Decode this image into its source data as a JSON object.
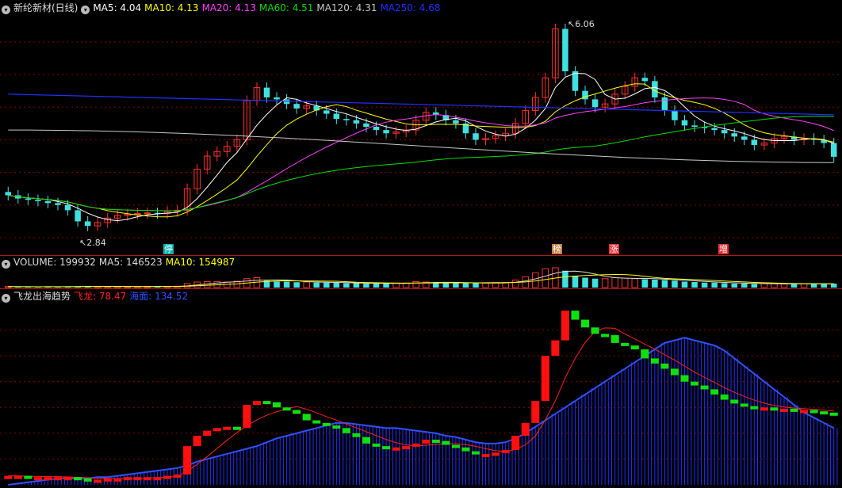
{
  "main": {
    "title": "新纶新材(日线)",
    "indicators": [
      {
        "label": "MA5: 4.04",
        "color": "#ffffff"
      },
      {
        "label": "MA10: 4.13",
        "color": "#ffff00"
      },
      {
        "label": "MA20: 4.13",
        "color": "#ff40ff"
      },
      {
        "label": "MA60: 4.51",
        "color": "#00e000"
      },
      {
        "label": "MA120: 4.31",
        "color": "#c8c8c8"
      },
      {
        "label": "MA250: 4.68",
        "color": "#2030ff"
      }
    ],
    "high_label": "6.06",
    "low_label": "2.84",
    "event_marks": [
      {
        "label": "停",
        "bg": "#00b0b0"
      },
      {
        "label": "榜",
        "bg": "#c08040"
      },
      {
        "label": "涨",
        "bg": "#e03030"
      },
      {
        "label": "增",
        "bg": "#e03030"
      }
    ]
  },
  "volume": {
    "items": [
      {
        "label": "VOLUME: 199932",
        "color": "#dddddd"
      },
      {
        "label": "MA5: 146523",
        "color": "#dddddd"
      },
      {
        "label": "MA10: 154987",
        "color": "#ffff00"
      }
    ]
  },
  "indicator": {
    "name": "飞龙出海趋势",
    "items": [
      {
        "label": "飞龙: 78.47",
        "color": "#ff2020"
      },
      {
        "label": "海面: 134.52",
        "color": "#3050ff"
      }
    ]
  },
  "colors": {
    "up": "#ff3030",
    "down": "#40e0e0",
    "grid": "#8b0000",
    "separator": "#b01818"
  },
  "chart_data": {
    "type": "candlestick",
    "close": [
      3.45,
      3.4,
      3.38,
      3.36,
      3.33,
      3.3,
      3.22,
      3.05,
      2.98,
      3.03,
      3.1,
      3.14,
      3.16,
      3.17,
      3.18,
      3.17,
      3.2,
      3.22,
      3.55,
      3.85,
      4.05,
      4.12,
      4.2,
      4.3,
      4.9,
      5.1,
      4.95,
      4.92,
      4.85,
      4.78,
      4.82,
      4.75,
      4.7,
      4.62,
      4.6,
      4.55,
      4.5,
      4.45,
      4.4,
      4.42,
      4.45,
      4.6,
      4.72,
      4.68,
      4.6,
      4.55,
      4.4,
      4.3,
      4.32,
      4.36,
      4.4,
      4.55,
      4.75,
      4.95,
      5.25,
      6.0,
      5.35,
      5.05,
      4.92,
      4.8,
      4.85,
      5.0,
      5.12,
      5.25,
      5.2,
      4.95,
      4.75,
      4.6,
      4.52,
      4.5,
      4.48,
      4.45,
      4.4,
      4.35,
      4.3,
      4.22,
      4.25,
      4.32,
      4.35,
      4.3,
      4.32,
      4.3,
      4.25,
      4.04
    ],
    "volume": [
      0.05,
      0.04,
      0.04,
      0.04,
      0.05,
      0.04,
      0.05,
      0.06,
      0.07,
      0.06,
      0.05,
      0.05,
      0.04,
      0.05,
      0.05,
      0.05,
      0.06,
      0.07,
      0.2,
      0.28,
      0.3,
      0.3,
      0.28,
      0.32,
      0.45,
      0.5,
      0.35,
      0.3,
      0.3,
      0.27,
      0.28,
      0.25,
      0.25,
      0.24,
      0.22,
      0.22,
      0.2,
      0.2,
      0.2,
      0.22,
      0.23,
      0.3,
      0.28,
      0.26,
      0.25,
      0.24,
      0.22,
      0.22,
      0.23,
      0.25,
      0.26,
      0.38,
      0.55,
      0.75,
      0.95,
      1.0,
      0.85,
      0.6,
      0.5,
      0.45,
      0.45,
      0.5,
      0.48,
      0.45,
      0.42,
      0.4,
      0.38,
      0.35,
      0.3,
      0.28,
      0.25,
      0.25,
      0.22,
      0.2,
      0.2,
      0.18,
      0.2,
      0.2,
      0.18,
      0.18,
      0.2,
      0.2,
      0.18,
      0.2
    ],
    "feilong": [
      7,
      7,
      6,
      6,
      6,
      6,
      6,
      5,
      4,
      4,
      5,
      5,
      6,
      6,
      6,
      6,
      7,
      8,
      30,
      38,
      42,
      44,
      45,
      44,
      62,
      65,
      64,
      60,
      58,
      55,
      50,
      48,
      46,
      44,
      40,
      37,
      32,
      30,
      28,
      29,
      30,
      32,
      35,
      34,
      31,
      29,
      26,
      24,
      24,
      25,
      27,
      38,
      48,
      65,
      100,
      112,
      135,
      128,
      122,
      117,
      116,
      110,
      108,
      105,
      98,
      94,
      90,
      85,
      80,
      77,
      74,
      70,
      66,
      63,
      61,
      60,
      60,
      59,
      59,
      58,
      58,
      57,
      56,
      55
    ],
    "haimian": [
      0,
      1,
      2,
      3,
      4,
      5,
      5,
      5,
      5,
      6,
      6,
      7,
      8,
      9,
      10,
      11,
      12,
      13,
      15,
      18,
      20,
      22,
      24,
      26,
      28,
      30,
      33,
      36,
      38,
      40,
      42,
      44,
      46,
      48,
      48,
      47,
      46,
      45,
      44,
      44,
      43,
      42,
      41,
      40,
      38,
      37,
      35,
      33,
      32,
      32,
      33,
      36,
      40,
      45,
      50,
      55,
      60,
      65,
      70,
      75,
      80,
      85,
      90,
      95,
      100,
      105,
      110,
      112,
      114,
      112,
      110,
      108,
      104,
      98,
      92,
      86,
      80,
      74,
      68,
      62,
      56,
      52,
      48,
      44
    ]
  }
}
